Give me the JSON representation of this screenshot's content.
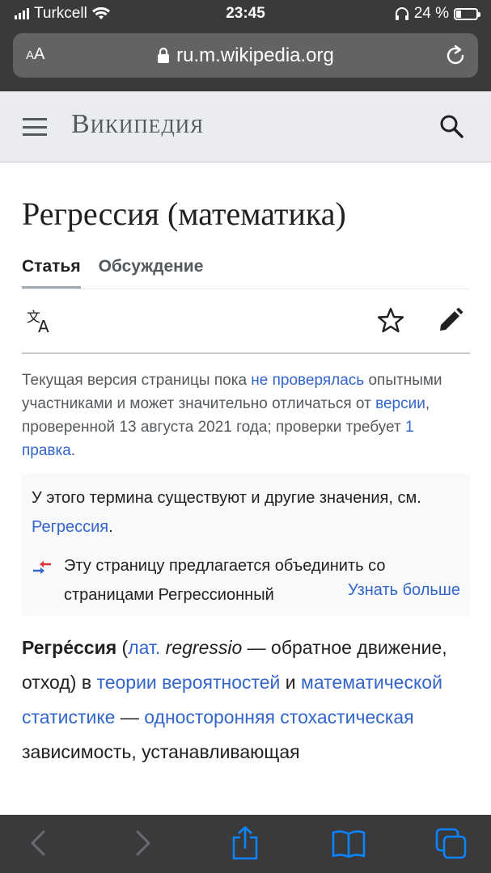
{
  "status_bar": {
    "carrier": "Turkcell",
    "time": "23:45",
    "battery": "24 %",
    "battery_level": 0.24
  },
  "browser": {
    "text_size_label_small": "A",
    "text_size_label_large": "A",
    "url": "ru.m.wikipedia.org"
  },
  "wiki": {
    "wordmark": "Википедия",
    "title": "Регрессия (математика)",
    "tabs": [
      {
        "label": "Статья",
        "active": true
      },
      {
        "label": "Обсуждение",
        "active": false
      }
    ]
  },
  "notice": {
    "part1": "Текущая версия страницы пока ",
    "link1": "не проверялась",
    "part2": " опытными участниками и может значительно отличаться от ",
    "link2": "версии",
    "part3": ", проверенной 13 августа 2021 года; проверки требует ",
    "link3": "1 правка",
    "part4": "."
  },
  "hatnote": {
    "text": "У этого термина существуют и другие значения, см. ",
    "link": "Регрессия",
    "end": "."
  },
  "merge": {
    "text": "Эту страницу предлагается объединить со страницами Регрессионный",
    "more": "Узнать больше"
  },
  "lead": {
    "term": "Регре́ссия",
    "open": " (",
    "lat_link": "лат.",
    "latin_word": " regressio",
    "after_latin": " — обратное движение, отход) в ",
    "link1": "теории вероятностей",
    "and": " и ",
    "link2": "математической статистике",
    "dash": " — ",
    "link3": "односторонняя стохастическая",
    "tail": " зависимость, устанавливающая"
  },
  "colors": {
    "link": "#3366cc",
    "chrome": "#3a3a3c",
    "ios_blue": "#0a84ff"
  },
  "icons": [
    "wifi-icon",
    "lock-icon",
    "reload-icon",
    "menu-icon",
    "search-icon",
    "language-icon",
    "star-icon",
    "edit-icon",
    "merge-icon",
    "back-icon",
    "forward-icon",
    "share-icon",
    "bookmarks-icon",
    "tabs-icon"
  ]
}
